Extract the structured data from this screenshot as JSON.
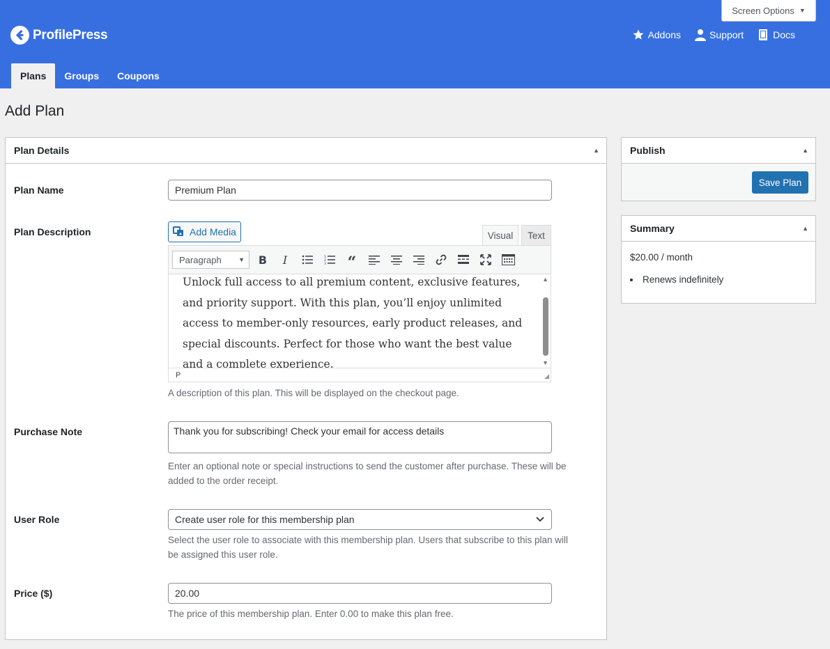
{
  "header": {
    "brand": "ProfilePress",
    "screen_options": "Screen Options",
    "links": [
      {
        "label": "Addons",
        "icon": "star-icon"
      },
      {
        "label": "Support",
        "icon": "person-icon"
      },
      {
        "label": "Docs",
        "icon": "book-icon"
      }
    ],
    "tabs": [
      {
        "label": "Plans",
        "active": true
      },
      {
        "label": "Groups",
        "active": false
      },
      {
        "label": "Coupons",
        "active": false
      }
    ]
  },
  "page": {
    "title": "Add Plan"
  },
  "plan_details": {
    "heading": "Plan Details",
    "plan_name": {
      "label": "Plan Name",
      "value": "Premium Plan"
    },
    "plan_description": {
      "label": "Plan Description",
      "add_media": "Add Media",
      "tab_visual": "Visual",
      "tab_text": "Text",
      "format": "Paragraph",
      "content": "Unlock full access to all premium content, exclusive features, and priority support. With this plan, you’ll enjoy unlimited access to member-only resources, early product releases, and special discounts. Perfect for those who want the best value and a complete experience.",
      "status_path": "P",
      "help": "A description of this plan. This will be displayed on the checkout page."
    },
    "purchase_note": {
      "label": "Purchase Note",
      "value": "Thank you for subscribing! Check your email for access details",
      "help": "Enter an optional note or special instructions to send the customer after purchase. These will be added to the order receipt."
    },
    "user_role": {
      "label": "User Role",
      "value": "Create user role for this membership plan",
      "help": "Select the user role to associate with this membership plan. Users that subscribe to this plan will be assigned this user role."
    },
    "price": {
      "label": "Price ($)",
      "value": "20.00",
      "help": "The price of this membership plan. Enter 0.00 to make this plan free."
    }
  },
  "publish": {
    "heading": "Publish",
    "save_label": "Save Plan"
  },
  "summary": {
    "heading": "Summary",
    "price": "$20.00 / month",
    "items": [
      "Renews indefinitely"
    ]
  }
}
